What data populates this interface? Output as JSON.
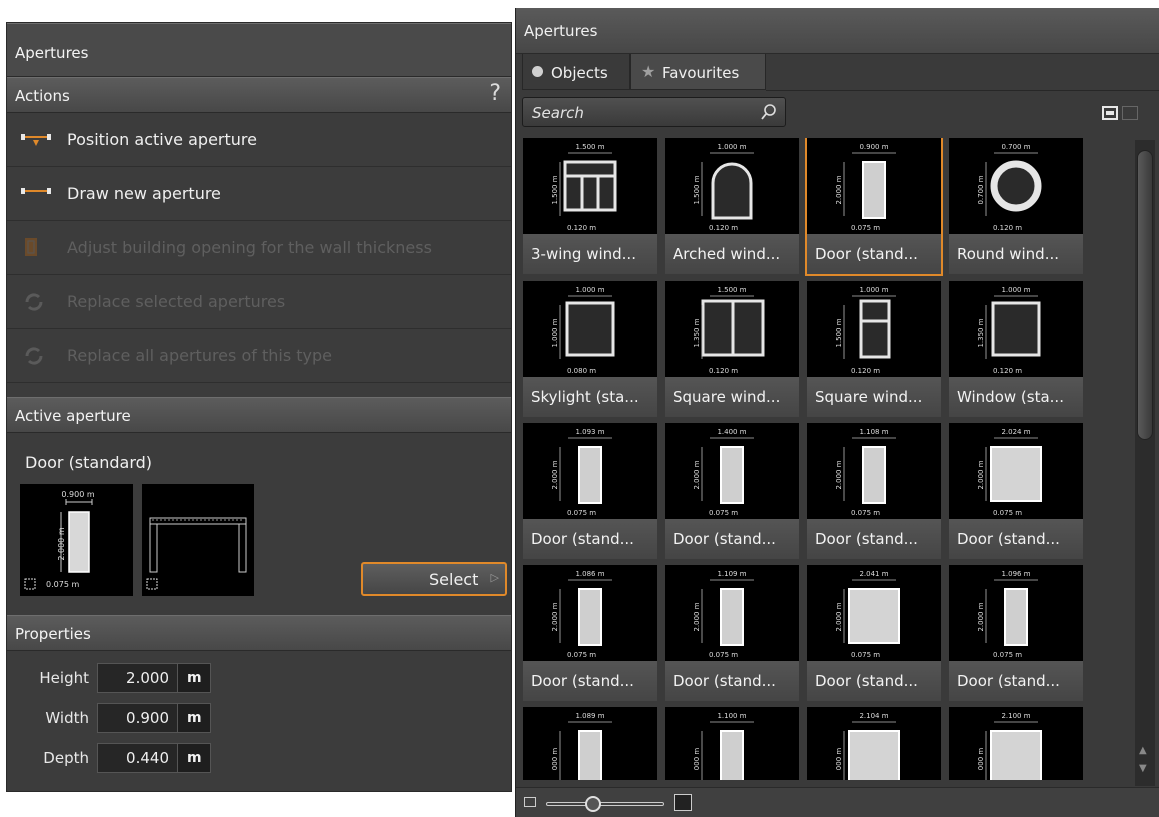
{
  "left": {
    "title": "Apertures",
    "actions_header": "Actions",
    "help": "?",
    "actions": [
      {
        "label": "Position active aperture",
        "enabled": true
      },
      {
        "label": "Draw new aperture",
        "enabled": true
      },
      {
        "label": "Adjust building opening for the wall thickness",
        "enabled": false
      },
      {
        "label": "Replace selected apertures",
        "enabled": false
      },
      {
        "label": "Replace all apertures of this type",
        "enabled": false
      }
    ],
    "active_header": "Active aperture",
    "active_name": "Door (standard)",
    "preview": {
      "width_dim": "0.900 m",
      "height_dim": "2.000 m",
      "depth_dim": "0.075 m"
    },
    "select_button": "Select",
    "properties_header": "Properties",
    "properties": [
      {
        "label": "Height",
        "value": "2.000",
        "unit": "m"
      },
      {
        "label": "Width",
        "value": "0.900",
        "unit": "m"
      },
      {
        "label": "Depth",
        "value": "0.440",
        "unit": "m"
      }
    ]
  },
  "right": {
    "title": "Apertures",
    "tabs": [
      "Objects",
      "Favourites"
    ],
    "search_placeholder": "Search",
    "tiles": [
      {
        "label": "3-wing wind...",
        "top_dim": "1.500 m",
        "side_dim": "1.500 m",
        "bottom_dim": "0.120 m",
        "shape": "3wing"
      },
      {
        "label": "Arched wind...",
        "top_dim": "1.000 m",
        "side_dim": "1.500 m",
        "bottom_dim": "0.120 m",
        "shape": "arch"
      },
      {
        "label": "Door (stand...",
        "top_dim": "0.900 m",
        "side_dim": "2.000 m",
        "bottom_dim": "0.075 m",
        "shape": "door",
        "selected": true
      },
      {
        "label": "Round wind...",
        "top_dim": "0.700 m",
        "side_dim": "0.700 m",
        "bottom_dim": "0.120 m",
        "shape": "round"
      },
      {
        "label": "Skylight (sta...",
        "top_dim": "1.000 m",
        "side_dim": "1.000 m",
        "bottom_dim": "0.080 m",
        "shape": "square"
      },
      {
        "label": "Square wind...",
        "top_dim": "1.500 m",
        "side_dim": "1.350 m",
        "bottom_dim": "0.120 m",
        "shape": "2wing"
      },
      {
        "label": "Square wind...",
        "top_dim": "1.000 m",
        "side_dim": "1.500 m",
        "bottom_dim": "0.120 m",
        "shape": "tophung"
      },
      {
        "label": "Window (sta...",
        "top_dim": "1.000 m",
        "side_dim": "1.350 m",
        "bottom_dim": "0.120 m",
        "shape": "square"
      },
      {
        "label": "Door (stand...",
        "top_dim": "1.093 m",
        "side_dim": "2.000 m",
        "bottom_dim": "0.075 m",
        "shape": "door"
      },
      {
        "label": "Door (stand...",
        "top_dim": "1.400 m",
        "side_dim": "2.000 m",
        "bottom_dim": "0.075 m",
        "shape": "door"
      },
      {
        "label": "Door (stand...",
        "top_dim": "1.108 m",
        "side_dim": "2.000 m",
        "bottom_dim": "0.075 m",
        "shape": "door"
      },
      {
        "label": "Door (stand...",
        "top_dim": "2.024 m",
        "side_dim": "2.000 m",
        "bottom_dim": "0.075 m",
        "shape": "wide"
      },
      {
        "label": "Door (stand...",
        "top_dim": "1.086 m",
        "side_dim": "2.000 m",
        "bottom_dim": "0.075 m",
        "shape": "door"
      },
      {
        "label": "Door (stand...",
        "top_dim": "1.109 m",
        "side_dim": "2.000 m",
        "bottom_dim": "0.075 m",
        "shape": "door"
      },
      {
        "label": "Door (stand...",
        "top_dim": "2.041 m",
        "side_dim": "2.000 m",
        "bottom_dim": "0.075 m",
        "shape": "wide"
      },
      {
        "label": "Door (stand...",
        "top_dim": "1.096 m",
        "side_dim": "2.000 m",
        "bottom_dim": "0.075 m",
        "shape": "door"
      },
      {
        "label": "",
        "top_dim": "1.089 m",
        "side_dim": "000 m",
        "bottom_dim": "",
        "shape": "door"
      },
      {
        "label": "",
        "top_dim": "1.100 m",
        "side_dim": "000 m",
        "bottom_dim": "",
        "shape": "door"
      },
      {
        "label": "",
        "top_dim": "2.104 m",
        "side_dim": "000 m",
        "bottom_dim": "",
        "shape": "wide"
      },
      {
        "label": "",
        "top_dim": "2.100 m",
        "side_dim": "000 m",
        "bottom_dim": "",
        "shape": "wide"
      }
    ],
    "zoom_level": 0.4
  },
  "colors": {
    "accent": "#e0892a",
    "panel": "#3c3c3c"
  }
}
